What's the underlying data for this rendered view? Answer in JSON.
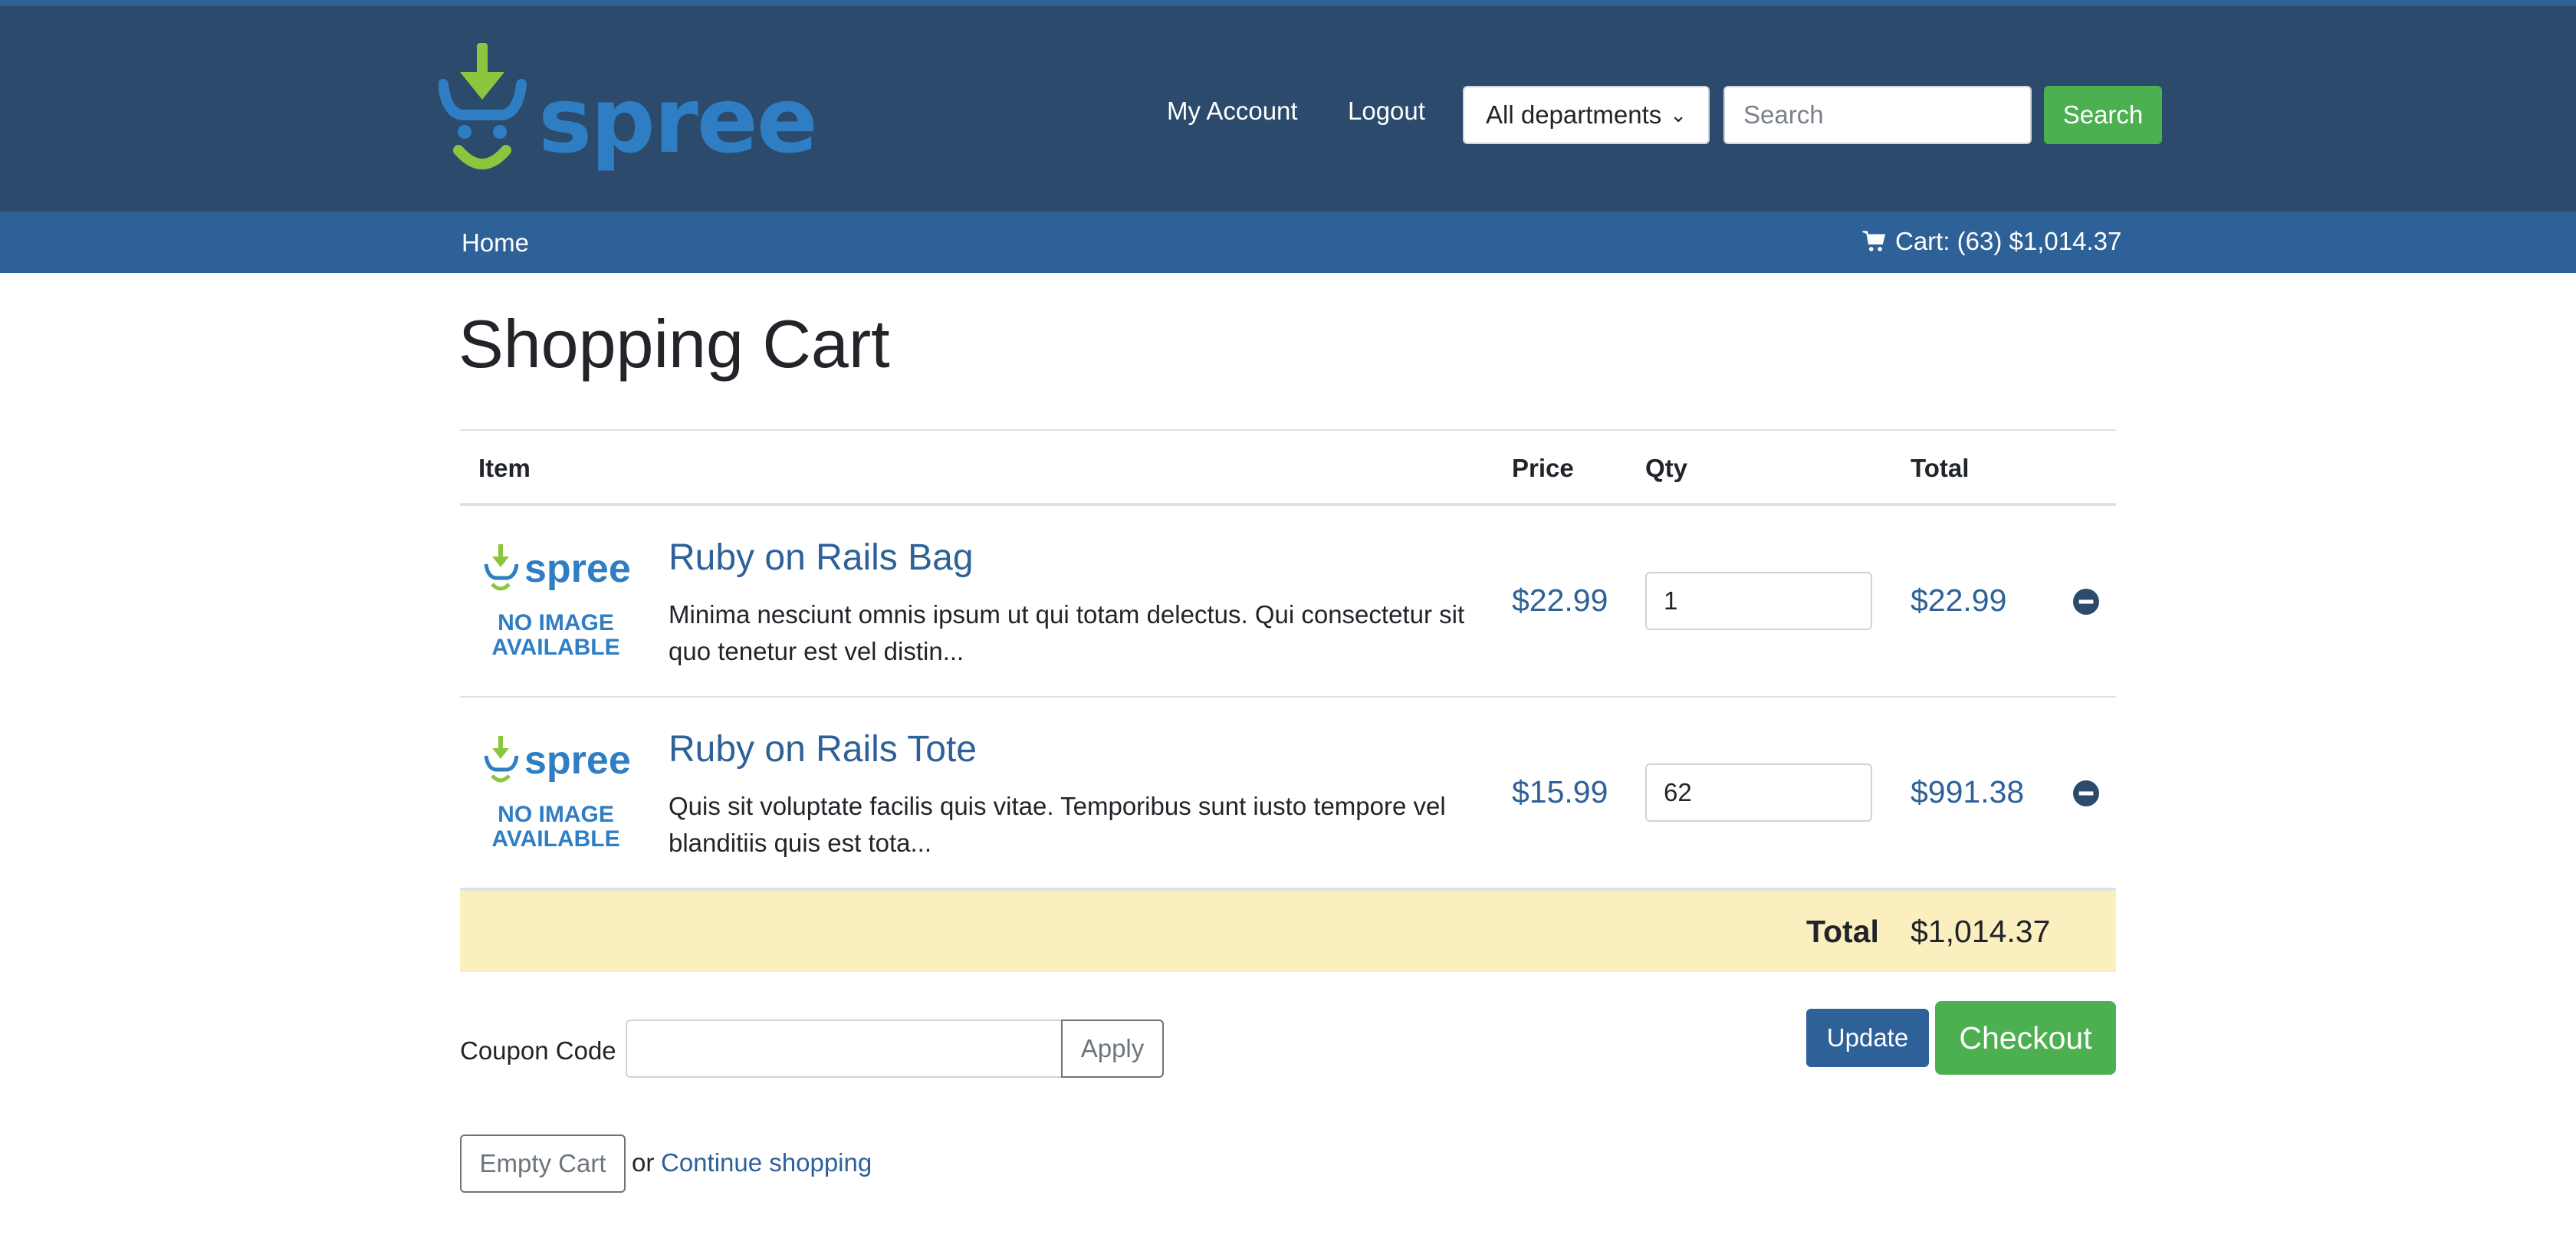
{
  "header": {
    "logo_text": "spree",
    "my_account": "My Account",
    "logout": "Logout",
    "department_selected": "All departments",
    "search_placeholder": "Search",
    "search_button": "Search"
  },
  "navbar": {
    "home": "Home",
    "cart_label": "Cart: (63) $1,014.37"
  },
  "page": {
    "title": "Shopping Cart"
  },
  "table": {
    "headers": {
      "item": "Item",
      "price": "Price",
      "qty": "Qty",
      "total": "Total"
    },
    "rows": [
      {
        "title": "Ruby on Rails Bag",
        "description": "Minima nesciunt omnis ipsum ut qui totam delectus. Qui consectetur sit quo tenetur est vel distin...",
        "price": "$22.99",
        "qty": "1",
        "total": "$22.99",
        "thumb_logo": "spree",
        "thumb_line1": "NO IMAGE",
        "thumb_line2": "AVAILABLE"
      },
      {
        "title": "Ruby on Rails Tote",
        "description": "Quis sit voluptate facilis quis vitae. Temporibus sunt iusto tempore vel blanditiis quis est tota...",
        "price": "$15.99",
        "qty": "62",
        "total": "$991.38",
        "thumb_logo": "spree",
        "thumb_line1": "NO IMAGE",
        "thumb_line2": "AVAILABLE"
      }
    ],
    "total_label": "Total",
    "total_value": "$1,014.37"
  },
  "actions": {
    "coupon_label": "Coupon Code",
    "apply": "Apply",
    "update": "Update",
    "checkout": "Checkout",
    "empty_cart": "Empty Cart",
    "or": "or",
    "continue_shopping": "Continue shopping"
  },
  "colors": {
    "header_bg": "#2b4a6c",
    "navbar_bg": "#2e6198",
    "accent_green": "#4caf50",
    "link_blue": "#2e6198",
    "total_row_bg": "#fcefbf"
  },
  "icons": {
    "cart": "cart-icon",
    "remove": "remove-icon",
    "logo": "spree-logo-icon"
  }
}
